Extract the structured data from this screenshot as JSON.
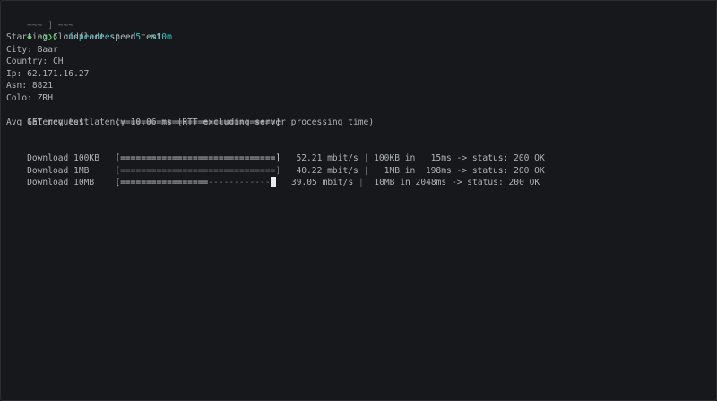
{
  "titlebar": {
    "left": "~~~",
    "sep": "]",
    "right": "~~~"
  },
  "prompt": {
    "marker": "◆",
    "cwd": "~",
    "chevrons": "❯❯❯",
    "command": "cfspeedtest -n5 -m10m"
  },
  "output": {
    "header": "Starting Cloudflare speed test",
    "city": "City: Baar",
    "country": "Country: CH",
    "ip": "Ip: 62.171.16.27",
    "asn": "Asn: 8821",
    "colo": "Colo: ZRH",
    "latency_label": "latency test     ",
    "latency_bar": "[==============================]",
    "latency_avg": "Avg GET request latency 10.06 ms (RTT excluding server processing time)"
  },
  "downloads": [
    {
      "label": "Download 100KB   ",
      "bar_filled": "[==============================]",
      "bar_empty": "",
      "speed": "   52.21 mbit/s",
      "sep": " | ",
      "size": "100KB in   15ms -> status: 200 OK"
    },
    {
      "label": "Download 1MB     ",
      "bar_filled": "[",
      "bar_empty": "==============================]",
      "speed": "   40.22 mbit/s",
      "sep": " | ",
      "size": "  1MB in  198ms -> status: 200 OK"
    },
    {
      "label": "Download 10MB    ",
      "bar_filled": "[=================",
      "bar_empty": "------------",
      "speed": "   39.05 mbit/s",
      "sep": " | ",
      "size": " 10MB in 2048ms -> status: 200 OK"
    }
  ],
  "colors": {
    "background": "#16181b",
    "text": "#aeb3b8",
    "accent_green": "#45d45a",
    "accent_cyan": "#3ec7c7"
  }
}
